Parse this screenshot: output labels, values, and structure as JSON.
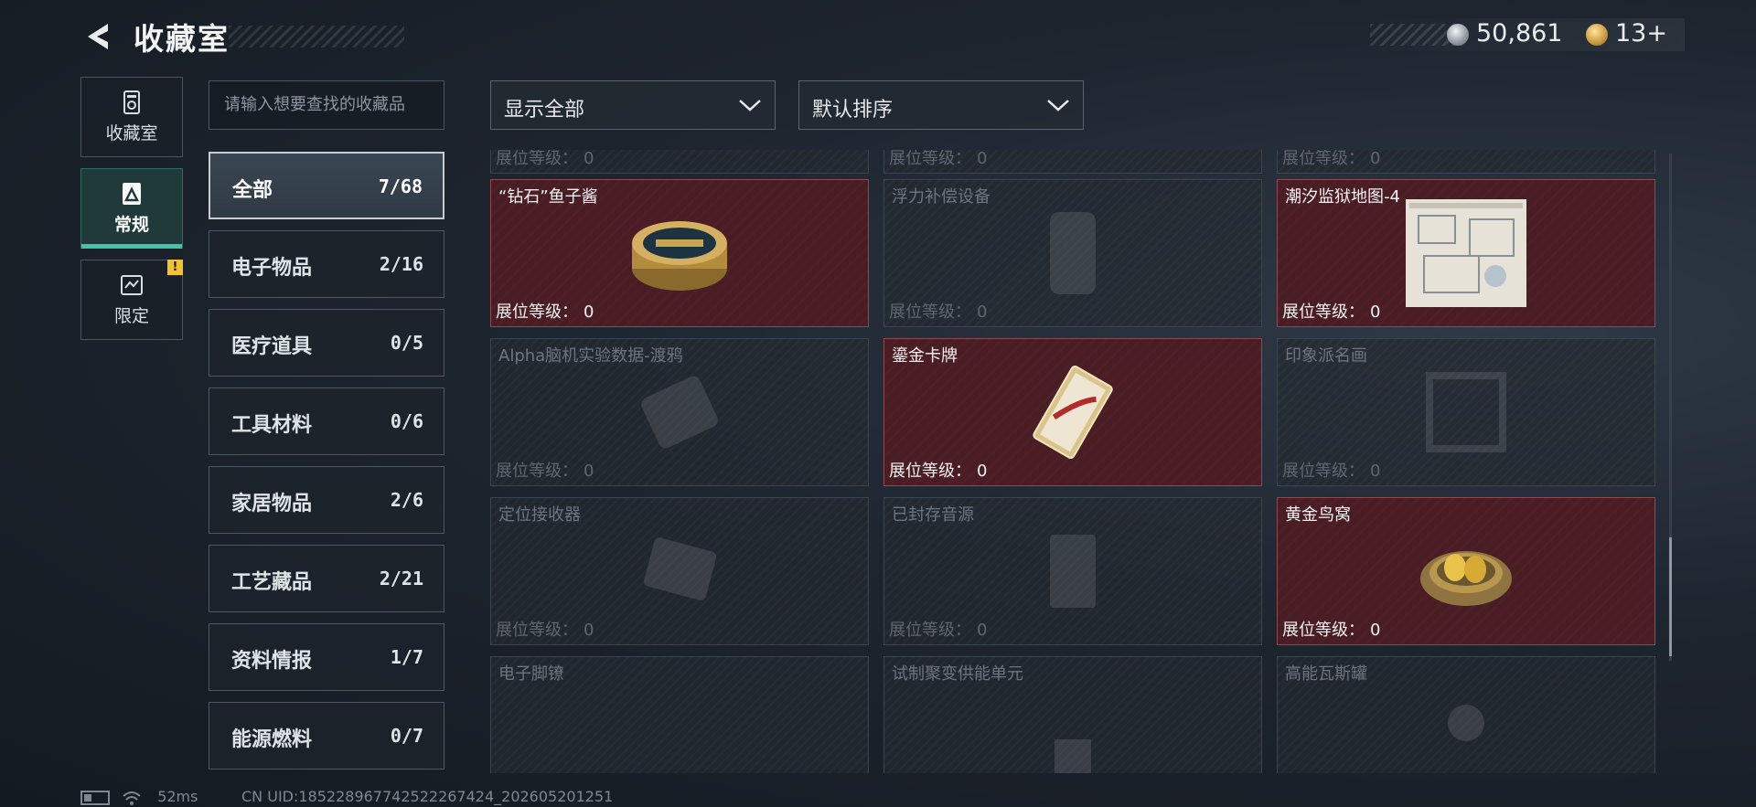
{
  "header": {
    "title": "收藏室",
    "currency": {
      "silver": "50,861",
      "gold": "13+"
    }
  },
  "side_tabs": [
    {
      "label": "收藏室",
      "icon": "collection-room-icon"
    },
    {
      "label": "常规",
      "icon": "regular-icon",
      "active": true
    },
    {
      "label": "限定",
      "icon": "limited-icon",
      "badge": "!"
    }
  ],
  "search": {
    "placeholder": "请输入想要查找的收藏品"
  },
  "categories": [
    {
      "name": "全部",
      "count": "7/68",
      "active": true
    },
    {
      "name": "电子物品",
      "count": "2/16"
    },
    {
      "name": "医疗道具",
      "count": "0/5"
    },
    {
      "name": "工具材料",
      "count": "0/6"
    },
    {
      "name": "家居物品",
      "count": "2/6"
    },
    {
      "name": "工艺藏品",
      "count": "2/21"
    },
    {
      "name": "资料情报",
      "count": "1/7"
    },
    {
      "name": "能源燃料",
      "count": "0/7"
    }
  ],
  "filters": {
    "display": "显示全部",
    "sort": "默认排序"
  },
  "level_label": "展位等级：",
  "cards": [
    {
      "name": "",
      "level": "0",
      "owned": false
    },
    {
      "name": "",
      "level": "0",
      "owned": false
    },
    {
      "name": "",
      "level": "0",
      "owned": false
    },
    {
      "name": "“钻石”鱼子酱",
      "level": "0",
      "owned": true,
      "icon": "caviar-icon"
    },
    {
      "name": "浮力补偿设备",
      "level": "0",
      "owned": false,
      "icon": "buoyancy-device-icon"
    },
    {
      "name": "潮汐监狱地图-4",
      "level": "0",
      "owned": true,
      "icon": "prison-map-icon"
    },
    {
      "name": "Alpha脑机实验数据-渡鸦",
      "level": "0",
      "owned": false,
      "icon": "brain-data-icon"
    },
    {
      "name": "鎏金卡牌",
      "level": "0",
      "owned": true,
      "icon": "gilded-card-icon"
    },
    {
      "name": "印象派名画",
      "level": "0",
      "owned": false,
      "icon": "painting-icon"
    },
    {
      "name": "定位接收器",
      "level": "0",
      "owned": false,
      "icon": "receiver-icon"
    },
    {
      "name": "已封存音源",
      "level": "0",
      "owned": false,
      "icon": "audio-source-icon"
    },
    {
      "name": "黄金鸟窝",
      "level": "0",
      "owned": true,
      "icon": "golden-nest-icon"
    },
    {
      "name": "电子脚镣",
      "level": "",
      "owned": false,
      "icon": "ankle-monitor-icon"
    },
    {
      "name": "试制聚变供能单元",
      "level": "",
      "owned": false,
      "icon": "fusion-unit-icon"
    },
    {
      "name": "高能瓦斯罐",
      "level": "",
      "owned": false,
      "icon": "gas-canister-icon"
    }
  ],
  "footer": {
    "ping": "52ms",
    "uid": "CN UID:18522896774252226742​4_202605201251"
  },
  "colors": {
    "accent": "#45c3a6",
    "owned_card": "#4a1d24",
    "warning": "#f2c230"
  }
}
